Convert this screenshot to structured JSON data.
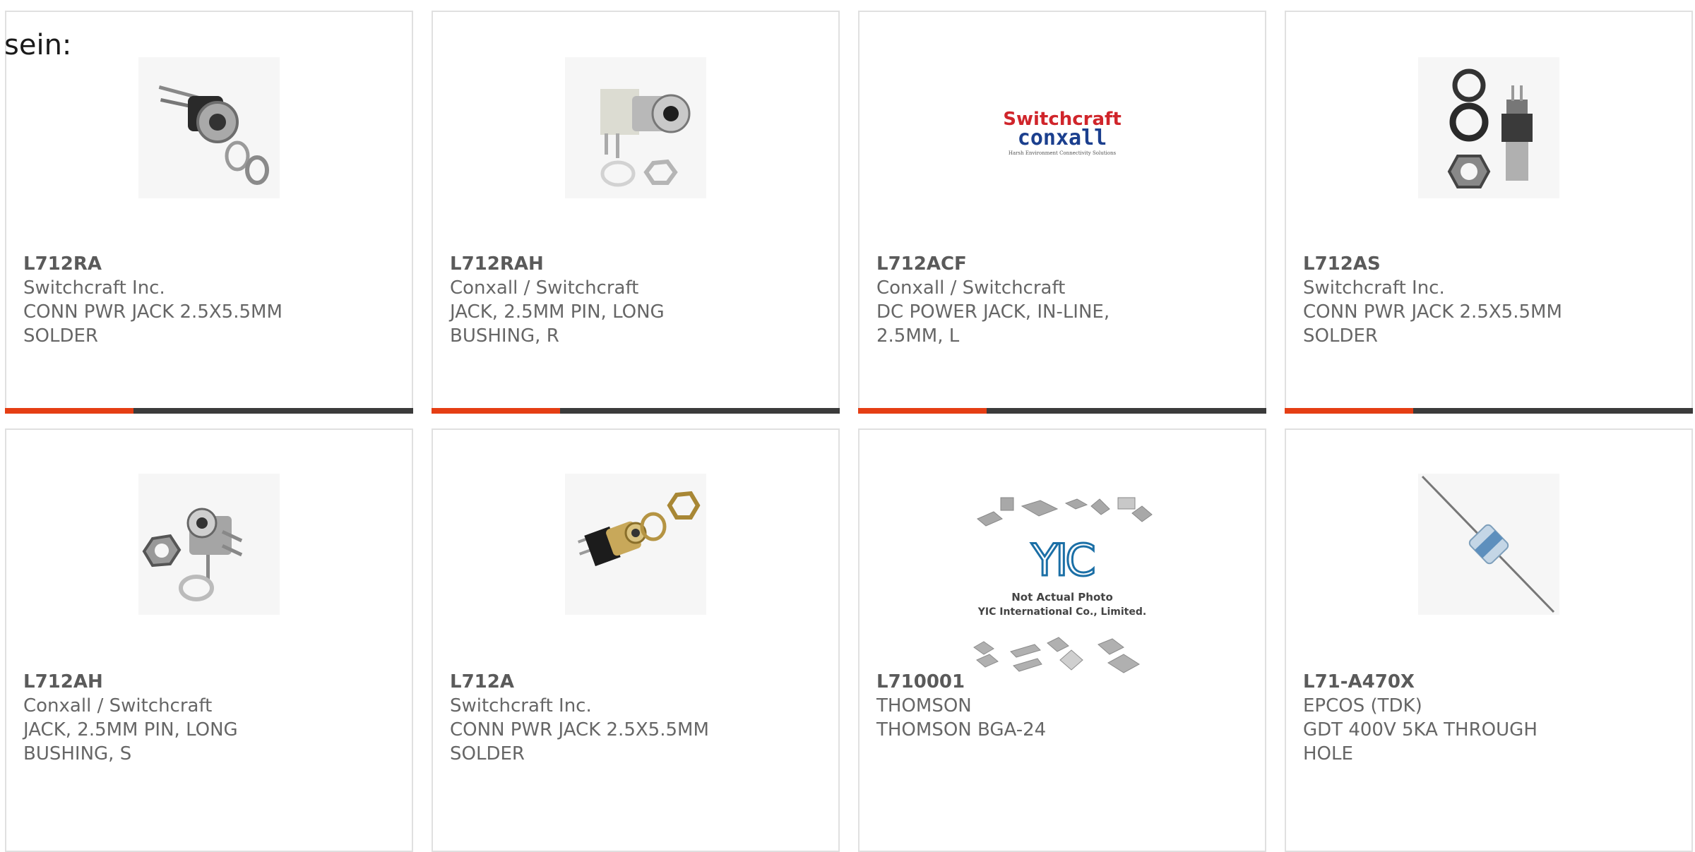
{
  "fragment_text": "sein:",
  "colors": {
    "accent": "#e53e14",
    "bar": "#3b3b3b",
    "border": "#e0e0e0",
    "text": "#666666"
  },
  "products": [
    {
      "part_number": "L712RA",
      "manufacturer": "Switchcraft Inc.",
      "description": "CONN PWR JACK 2.5X5.5MM SOLDER",
      "image": "dc-jack-photo"
    },
    {
      "part_number": "L712RAH",
      "manufacturer": "Conxall / Switchcraft",
      "description": "JACK, 2.5MM PIN, LONG BUSHING, R",
      "image": "dc-jack-photo"
    },
    {
      "part_number": "L712ACF",
      "manufacturer": "Conxall / Switchcraft",
      "description": "DC POWER JACK, IN-LINE, 2.5MM, L",
      "image": "brand-logo",
      "logo": {
        "line1": "Switchcraft",
        "line2": "conxall",
        "tagline": "Harsh Environment Connectivity Solutions"
      }
    },
    {
      "part_number": "L712AS",
      "manufacturer": "Switchcraft Inc.",
      "description": "CONN PWR JACK 2.5X5.5MM SOLDER",
      "image": "dc-jack-photo"
    },
    {
      "part_number": "L712AH",
      "manufacturer": "Conxall / Switchcraft",
      "description": "JACK, 2.5MM PIN, LONG BUSHING, S",
      "image": "dc-jack-photo"
    },
    {
      "part_number": "L712A",
      "manufacturer": "Switchcraft Inc.",
      "description": "CONN PWR JACK 2.5X5.5MM SOLDER",
      "image": "dc-jack-photo"
    },
    {
      "part_number": "L710001",
      "manufacturer": "THOMSON",
      "description": "THOMSON BGA-24",
      "image": "placeholder",
      "placeholder": {
        "logo": "YIC",
        "line1": "Not Actual Photo",
        "line2": "YIC International Co., Limited."
      }
    },
    {
      "part_number": "L71-A470X",
      "manufacturer": "EPCOS (TDK)",
      "description": "GDT 400V 5KA THROUGH HOLE",
      "image": "gdt-photo"
    }
  ]
}
